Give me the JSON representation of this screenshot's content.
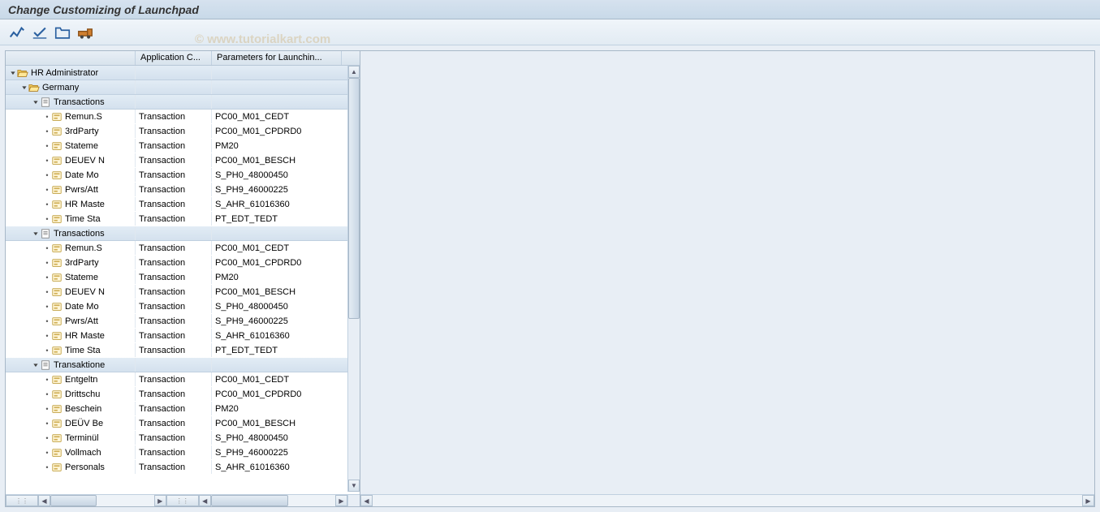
{
  "title": "Change Customizing of Launchpad",
  "watermark": "© www.tutorialkart.com",
  "toolbar": {
    "btn1": "toggle-display",
    "btn2": "check",
    "btn3": "new-folder",
    "btn4": "transport"
  },
  "columns": {
    "tree": "",
    "app": "Application C...",
    "param": "Parameters for Launchin..."
  },
  "tree": {
    "root": {
      "label": "HR Administrator",
      "expanded": true,
      "icon": "folder-open",
      "children": [
        {
          "label": "Germany",
          "expanded": true,
          "icon": "folder-open",
          "children": [
            {
              "label": "Transactions",
              "expanded": true,
              "icon": "doc",
              "items": [
                {
                  "label": "Remun.S",
                  "app": "Transaction",
                  "param": "PC00_M01_CEDT"
                },
                {
                  "label": "3rdParty",
                  "app": "Transaction",
                  "param": "PC00_M01_CPDRD0"
                },
                {
                  "label": "Stateme",
                  "app": "Transaction",
                  "param": "PM20"
                },
                {
                  "label": "DEUEV N",
                  "app": "Transaction",
                  "param": "PC00_M01_BESCH"
                },
                {
                  "label": "Date Mo",
                  "app": "Transaction",
                  "param": "S_PH0_48000450"
                },
                {
                  "label": "Pwrs/Att",
                  "app": "Transaction",
                  "param": "S_PH9_46000225"
                },
                {
                  "label": "HR Maste",
                  "app": "Transaction",
                  "param": "S_AHR_61016360"
                },
                {
                  "label": "Time Sta",
                  "app": "Transaction",
                  "param": "PT_EDT_TEDT"
                }
              ]
            },
            {
              "label": "Transactions",
              "expanded": true,
              "icon": "doc",
              "items": [
                {
                  "label": "Remun.S",
                  "app": "Transaction",
                  "param": "PC00_M01_CEDT"
                },
                {
                  "label": "3rdParty",
                  "app": "Transaction",
                  "param": "PC00_M01_CPDRD0"
                },
                {
                  "label": "Stateme",
                  "app": "Transaction",
                  "param": "PM20"
                },
                {
                  "label": "DEUEV N",
                  "app": "Transaction",
                  "param": "PC00_M01_BESCH"
                },
                {
                  "label": "Date Mo",
                  "app": "Transaction",
                  "param": "S_PH0_48000450"
                },
                {
                  "label": "Pwrs/Att",
                  "app": "Transaction",
                  "param": "S_PH9_46000225"
                },
                {
                  "label": "HR Maste",
                  "app": "Transaction",
                  "param": "S_AHR_61016360"
                },
                {
                  "label": "Time Sta",
                  "app": "Transaction",
                  "param": "PT_EDT_TEDT"
                }
              ]
            },
            {
              "label": "Transaktione",
              "expanded": true,
              "icon": "doc",
              "items": [
                {
                  "label": "Entgeltn",
                  "app": "Transaction",
                  "param": "PC00_M01_CEDT"
                },
                {
                  "label": "Drittschu",
                  "app": "Transaction",
                  "param": "PC00_M01_CPDRD0"
                },
                {
                  "label": "Beschein",
                  "app": "Transaction",
                  "param": "PM20"
                },
                {
                  "label": "DEÜV Be",
                  "app": "Transaction",
                  "param": "PC00_M01_BESCH"
                },
                {
                  "label": "Terminül",
                  "app": "Transaction",
                  "param": "S_PH0_48000450"
                },
                {
                  "label": "Vollmach",
                  "app": "Transaction",
                  "param": "S_PH9_46000225"
                },
                {
                  "label": "Personals",
                  "app": "Transaction",
                  "param": "S_AHR_61016360"
                }
              ]
            }
          ]
        }
      ]
    }
  }
}
